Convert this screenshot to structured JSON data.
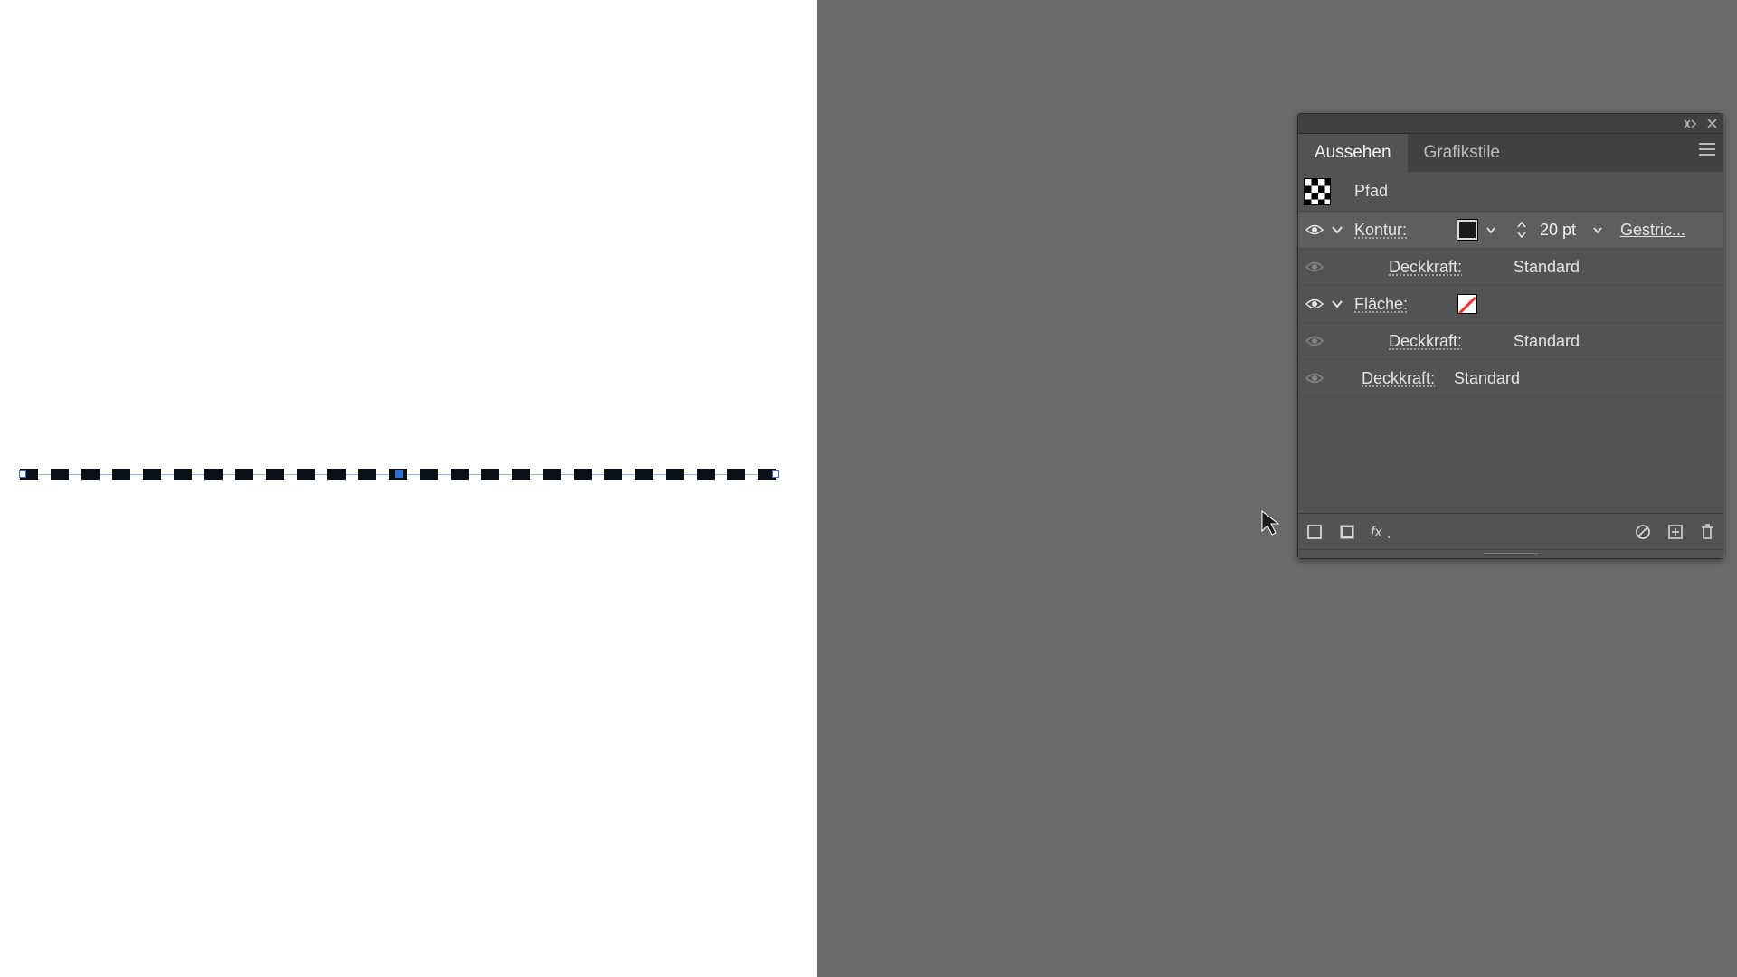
{
  "tabs": {
    "appearance": "Aussehen",
    "graphic_styles": "Grafikstile"
  },
  "object": {
    "name": "Pfad"
  },
  "stroke": {
    "label": "Kontur:",
    "weight": "20 pt",
    "brush": "Gestric..."
  },
  "fill": {
    "label": "Fläche:"
  },
  "opacity": {
    "label": "Deckkraft:",
    "value": "Standard"
  }
}
